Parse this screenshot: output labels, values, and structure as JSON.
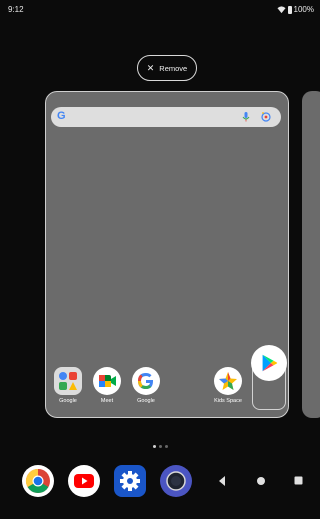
{
  "status": {
    "time": "9:12",
    "battery": "100%"
  },
  "remove_button": {
    "label": "Remove",
    "icon": "close-icon"
  },
  "search": {
    "icons": [
      "google-g-icon",
      "mic-icon",
      "lens-icon"
    ]
  },
  "apps": [
    {
      "label": "Google",
      "icon": "folder-icon"
    },
    {
      "label": "Meet",
      "icon": "meet-icon"
    },
    {
      "label": "Google",
      "icon": "google-icon"
    },
    {
      "label": "Kids Space",
      "icon": "kids-space-icon"
    }
  ],
  "dragged_app": {
    "icon": "play-store-icon"
  },
  "dock": {
    "icons": [
      "chrome-icon",
      "youtube-icon",
      "settings-icon",
      "camera-icon"
    ]
  },
  "nav": {
    "icons": [
      "back-icon",
      "home-icon",
      "overview-icon"
    ]
  },
  "colors": {
    "background": "#0b0b0b",
    "card": "#6b6b6b",
    "settings_blue": "#1a56c9",
    "youtube_red": "#ff0000"
  }
}
